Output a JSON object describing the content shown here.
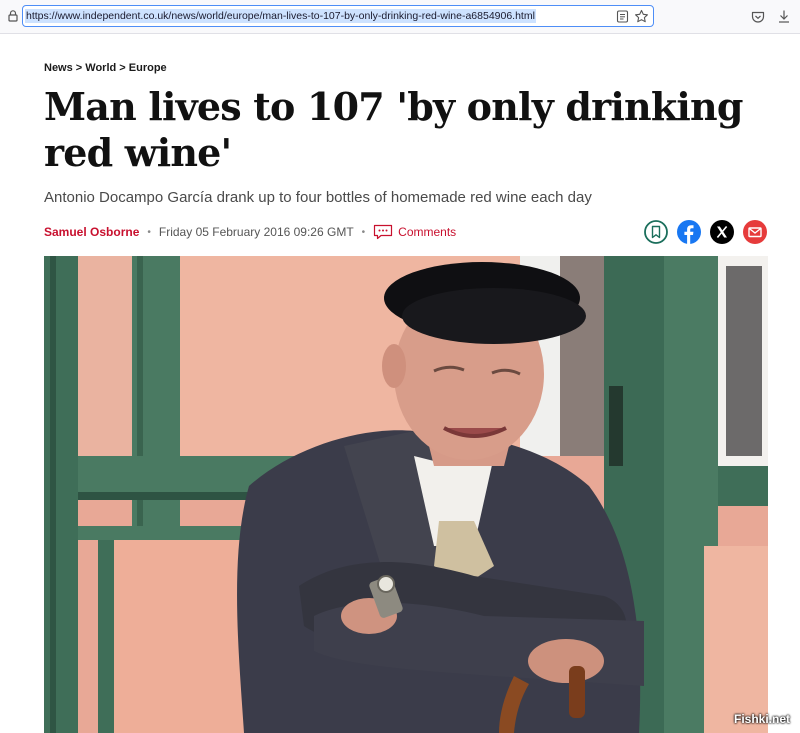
{
  "browser": {
    "url": "https://www.independent.co.uk/news/world/europe/man-lives-to-107-by-only-drinking-red-wine-a6854906.html",
    "accent_color": "#4e8ef7"
  },
  "article": {
    "breadcrumb": "News > World > Europe",
    "headline": "Man lives to 107 'by only drinking red wine'",
    "standfirst": "Antonio Docampo García drank up to four bottles of homemade red wine each day",
    "author": "Samuel Osborne",
    "date": "Friday 05 February 2016 09:26 GMT",
    "comments_label": "Comments",
    "brand_color": "#c8102e"
  },
  "share_icons": [
    "bookmark-icon",
    "facebook-icon",
    "x-icon",
    "email-icon"
  ],
  "watermark": "Fishki.net"
}
